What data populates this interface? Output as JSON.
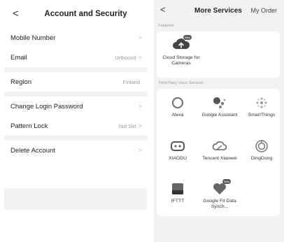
{
  "left": {
    "header": {
      "back": "<",
      "title": "Account and Security"
    },
    "groups": [
      {
        "rows": [
          {
            "label": "Mobile Number",
            "value": ""
          },
          {
            "label": "Email",
            "value": "Unbound"
          }
        ]
      },
      {
        "rows": [
          {
            "label": "Region",
            "value": "Finland"
          }
        ]
      },
      {
        "rows": [
          {
            "label": "Change Login Password",
            "value": ""
          },
          {
            "label": "Pattern Lock",
            "value": "Not Set"
          }
        ]
      },
      {
        "rows": [
          {
            "label": "Delete Account",
            "value": ""
          }
        ]
      }
    ],
    "chevron": ">"
  },
  "right": {
    "header": {
      "back": "<",
      "title": "More Services",
      "order": "My Order"
    },
    "featured_label": "Featured",
    "featured": [
      {
        "label": "Cloud Storage for Cameras",
        "badge": "New",
        "icon": "cloud-upload-icon"
      }
    ],
    "voice_label": "Third-Party Voice Services",
    "services": [
      {
        "label": "Alexa",
        "icon": "alexa-icon",
        "badge": ""
      },
      {
        "label": "Google Assistant",
        "icon": "google-assistant-icon",
        "badge": ""
      },
      {
        "label": "SmartThings",
        "icon": "smartthings-icon",
        "badge": ""
      },
      {
        "label": "XIAODU",
        "icon": "xiaodu-icon",
        "badge": ""
      },
      {
        "label": "Tencent Xiaowei",
        "icon": "tencent-xiaowei-icon",
        "badge": ""
      },
      {
        "label": "DingDong",
        "icon": "dingdong-icon",
        "badge": ""
      },
      {
        "label": "IFTTT",
        "icon": "ifttt-icon",
        "badge": ""
      },
      {
        "label": "Google Fit Data Synch...",
        "icon": "google-fit-icon",
        "badge": "New"
      }
    ]
  }
}
